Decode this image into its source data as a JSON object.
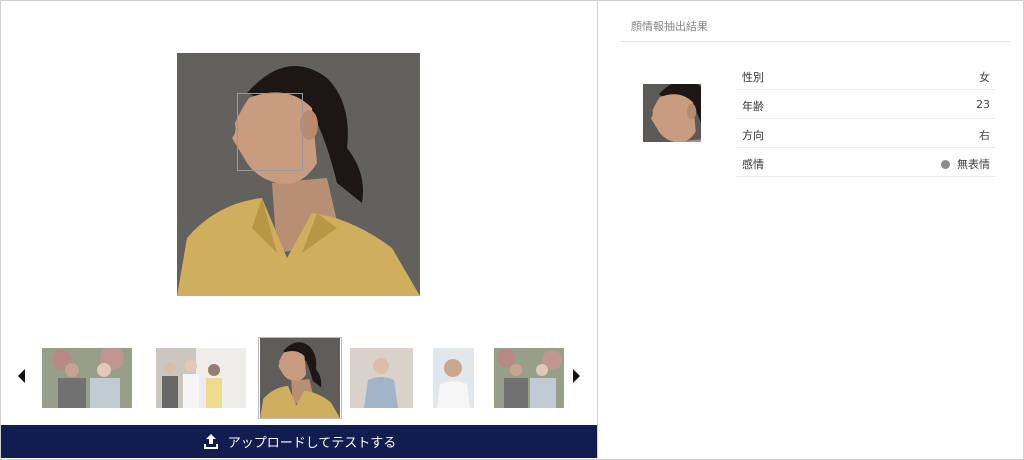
{
  "result_panel": {
    "title": "顔情報抽出結果",
    "attributes": [
      {
        "key": "性別",
        "value": "女"
      },
      {
        "key": "年齢",
        "value": "23"
      },
      {
        "key": "方向",
        "value": "右"
      },
      {
        "key": "感情",
        "value": "無表情"
      }
    ],
    "emotion_color": "#8c8c8c"
  },
  "upload": {
    "label": "アップロードしてテストする",
    "icon": "upload-icon"
  },
  "carousel": {
    "prev_icon": "triangle-left-icon",
    "next_icon": "triangle-right-icon"
  },
  "colors": {
    "upload_bg": "#111c50"
  }
}
